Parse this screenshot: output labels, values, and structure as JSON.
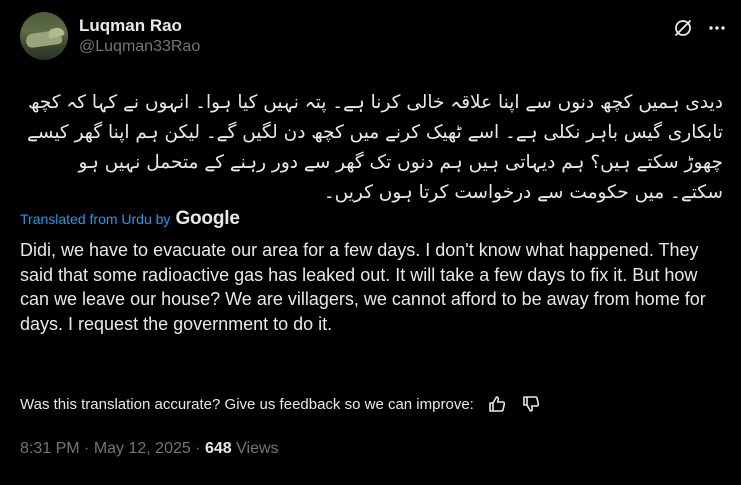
{
  "author": {
    "display_name": "Luqman Rao",
    "handle": "@Luqman33Rao"
  },
  "icons": {
    "avatar": "crocodile-avatar",
    "grok": "grok-icon",
    "more": "more-dots-icon",
    "thumbs_up": "thumbs-up-icon",
    "thumbs_down": "thumbs-down-icon"
  },
  "tweet": {
    "original_text": "دیدی ہمیں کچھ دنوں سے اپنا علاقہ خالی کرنا ہے۔ پتہ نہیں کیا ہوا۔ انہوں نے کہا کہ کچھ تابکاری گیس باہر نکلی ہے۔ اسے ٹھیک کرنے میں کچھ دن لگیں گے۔ لیکن ہم اپنا گھر کیسے چھوڑ سکتے ہیں؟ ہم دیہاتی ہیں ہم دنوں تک گھر سے دور رہنے کے متحمل نہیں ہو سکتے۔ میں حکومت سے درخواست کرتا ہوں کریں۔",
    "translated_from_label": "Translated from Urdu by",
    "translator_brand": "Google",
    "translation_text": "Didi, we have to evacuate our area for a few days. I don't know what happened. They said that some radioactive gas has leaked out. It will take a few days to fix it. But how can we leave our house? We are villagers, we cannot afford to be away from home for days. I request the government to do it.",
    "feedback_prompt": "Was this translation accurate? Give us feedback so we can improve:",
    "time": "8:31 PM",
    "separator": " · ",
    "date": "May 12, 2025",
    "views_count": "648",
    "views_label": " Views"
  },
  "colors": {
    "background": "#000000",
    "text_primary": "#e7e9ea",
    "text_secondary": "#71767b",
    "accent": "#1d9bf0"
  }
}
